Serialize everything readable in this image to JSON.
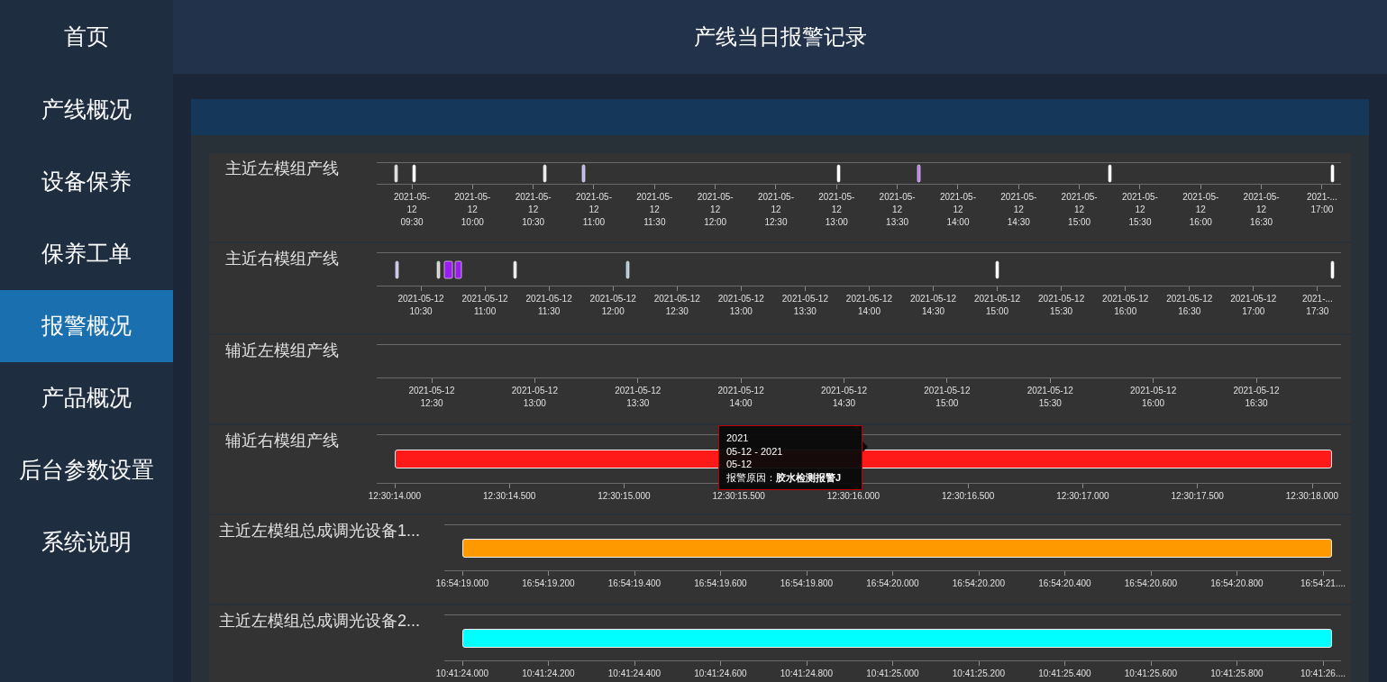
{
  "sidebar": {
    "items": [
      {
        "label": "首页",
        "selected": false
      },
      {
        "label": "产线概况",
        "selected": false
      },
      {
        "label": "设备保养",
        "selected": false
      },
      {
        "label": "保养工单",
        "selected": false
      },
      {
        "label": "报警概况",
        "selected": true
      },
      {
        "label": "产品概况",
        "selected": false
      },
      {
        "label": "后台参数设置",
        "selected": false
      },
      {
        "label": "系统说明",
        "selected": false
      }
    ]
  },
  "header": {
    "title": "产线当日报警记录"
  },
  "timelines": [
    {
      "label": "主近左模组产线",
      "kind": "marks",
      "ticks": [
        {
          "date": "2021-05-12",
          "time": "09:30"
        },
        {
          "date": "2021-05-12",
          "time": "10:00"
        },
        {
          "date": "2021-05-12",
          "time": "10:30"
        },
        {
          "date": "2021-05-12",
          "time": "11:00"
        },
        {
          "date": "2021-05-12",
          "time": "11:30"
        },
        {
          "date": "2021-05-12",
          "time": "12:00"
        },
        {
          "date": "2021-05-12",
          "time": "12:30"
        },
        {
          "date": "2021-05-12",
          "time": "13:00"
        },
        {
          "date": "2021-05-12",
          "time": "13:30"
        },
        {
          "date": "2021-05-12",
          "time": "14:00"
        },
        {
          "date": "2021-05-12",
          "time": "14:30"
        },
        {
          "date": "2021-05-12",
          "time": "15:00"
        },
        {
          "date": "2021-05-12",
          "time": "15:30"
        },
        {
          "date": "2021-05-12",
          "time": "16:00"
        },
        {
          "date": "2021-05-12",
          "time": "16:30"
        },
        {
          "date": "2021-...",
          "time": "17:00"
        }
      ]
    },
    {
      "label": "主近右模组产线",
      "kind": "marks",
      "ticks": [
        {
          "date": "2021-05-12",
          "time": "10:30"
        },
        {
          "date": "2021-05-12",
          "time": "11:00"
        },
        {
          "date": "2021-05-12",
          "time": "11:30"
        },
        {
          "date": "2021-05-12",
          "time": "12:00"
        },
        {
          "date": "2021-05-12",
          "time": "12:30"
        },
        {
          "date": "2021-05-12",
          "time": "13:00"
        },
        {
          "date": "2021-05-12",
          "time": "13:30"
        },
        {
          "date": "2021-05-12",
          "time": "14:00"
        },
        {
          "date": "2021-05-12",
          "time": "14:30"
        },
        {
          "date": "2021-05-12",
          "time": "15:00"
        },
        {
          "date": "2021-05-12",
          "time": "15:30"
        },
        {
          "date": "2021-05-12",
          "time": "16:00"
        },
        {
          "date": "2021-05-12",
          "time": "16:30"
        },
        {
          "date": "2021-05-12",
          "time": "17:00"
        },
        {
          "date": "2021-...",
          "time": "17:30"
        }
      ]
    },
    {
      "label": "辅近左模组产线",
      "kind": "empty",
      "ticks": [
        {
          "date": "2021-05-12",
          "time": "12:30"
        },
        {
          "date": "2021-05-12",
          "time": "13:00"
        },
        {
          "date": "2021-05-12",
          "time": "13:30"
        },
        {
          "date": "2021-05-12",
          "time": "14:00"
        },
        {
          "date": "2021-05-12",
          "time": "14:30"
        },
        {
          "date": "2021-05-12",
          "time": "15:00"
        },
        {
          "date": "2021-05-12",
          "time": "15:30"
        },
        {
          "date": "2021-05-12",
          "time": "16:00"
        },
        {
          "date": "2021-05-12",
          "time": "16:30"
        }
      ]
    },
    {
      "label": "辅近右模组产线",
      "kind": "bar",
      "color": "#ff1a1a",
      "ticks": [
        {
          "time": "12:30:14.000"
        },
        {
          "time": "12:30:14.500"
        },
        {
          "time": "12:30:15.000"
        },
        {
          "time": "12:30:15.500"
        },
        {
          "time": "12:30:16.000"
        },
        {
          "time": "12:30:16.500"
        },
        {
          "time": "12:30:17.000"
        },
        {
          "time": "12:30:17.500"
        },
        {
          "time": "12:30:18.000"
        }
      ],
      "tooltip": {
        "lines": [
          "2021",
          "05-12 - 2021",
          "05-12"
        ],
        "reason": "报警原因：**胶水检测报警J**"
      }
    },
    {
      "label": "主近左模组总成调光设备1...",
      "kind": "bar",
      "color": "#ff9900",
      "ticks": [
        {
          "time": "16:54:19.000"
        },
        {
          "time": "16:54:19.200"
        },
        {
          "time": "16:54:19.400"
        },
        {
          "time": "16:54:19.600"
        },
        {
          "time": "16:54:19.800"
        },
        {
          "time": "16:54:20.000"
        },
        {
          "time": "16:54:20.200"
        },
        {
          "time": "16:54:20.400"
        },
        {
          "time": "16:54:20.600"
        },
        {
          "time": "16:54:20.800"
        },
        {
          "time": "16:54:21...."
        }
      ]
    },
    {
      "label": "主近左模组总成调光设备2...",
      "kind": "bar",
      "color": "#00ffff",
      "ticks": [
        {
          "time": "10:41:24.000"
        },
        {
          "time": "10:41:24.200"
        },
        {
          "time": "10:41:24.400"
        },
        {
          "time": "10:41:24.600"
        },
        {
          "time": "10:41:24.800"
        },
        {
          "time": "10:41:25.000"
        },
        {
          "time": "10:41:25.200"
        },
        {
          "time": "10:41:25.400"
        },
        {
          "time": "10:41:25.600"
        },
        {
          "time": "10:41:25.800"
        },
        {
          "time": "10:41:26...."
        }
      ]
    }
  ]
}
